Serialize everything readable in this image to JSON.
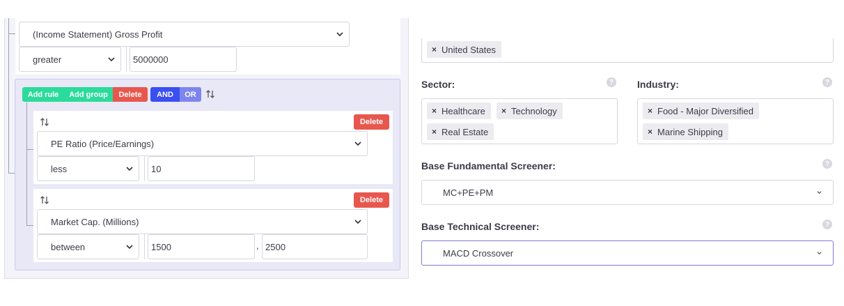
{
  "builder": {
    "top_rule": {
      "field": "(Income Statement) Gross Profit",
      "operator": "greater",
      "value": "5000000"
    },
    "group": {
      "buttons": {
        "add_rule": "Add rule",
        "add_group": "Add group",
        "delete": "Delete",
        "and": "AND",
        "or": "OR"
      },
      "rules": [
        {
          "field": "PE Ratio (Price/Earnings)",
          "operator": "less",
          "value": "10",
          "delete_label": "Delete"
        },
        {
          "field": "Market Cap. (Millions)",
          "operator": "between",
          "value": "1500",
          "separator": ",",
          "value2": "2500",
          "delete_label": "Delete"
        }
      ]
    }
  },
  "filters": {
    "country": {
      "tags": [
        "United States"
      ]
    },
    "sector": {
      "label": "Sector:",
      "tags": [
        "Healthcare",
        "Technology",
        "Real Estate"
      ]
    },
    "industry": {
      "label": "Industry:",
      "tags": [
        "Food - Major Diversified",
        "Marine Shipping"
      ]
    },
    "base_fundamental": {
      "label": "Base Fundamental Screener:",
      "value": "MC+PE+PM"
    },
    "base_technical": {
      "label": "Base Technical Screener:",
      "value": "MACD Crossover"
    },
    "help_glyph": "?",
    "remove_glyph": "×"
  },
  "colors": {
    "green": "#2bdb9a",
    "red": "#e8574e",
    "blue": "#3b4ef2",
    "blue_light": "#7d86ee",
    "focus_border": "#7f79d8"
  }
}
